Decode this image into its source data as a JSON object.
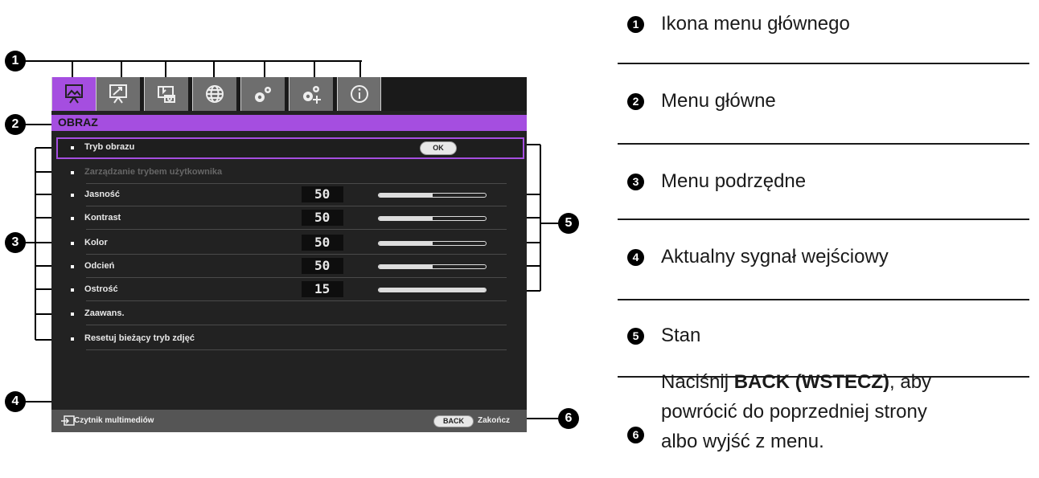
{
  "osd": {
    "tabs": [
      {
        "icon": "picture-icon"
      },
      {
        "icon": "display-icon"
      },
      {
        "icon": "installation-icon"
      },
      {
        "icon": "system-settings-globe-icon"
      },
      {
        "icon": "basic-settings-gears-icon"
      },
      {
        "icon": "advanced-settings-gears-icon"
      },
      {
        "icon": "information-icon"
      }
    ],
    "menu_title": "OBRAZ",
    "rows": [
      {
        "label": "Tryb obrazu",
        "button": "OK",
        "selected": true
      },
      {
        "label": "Zarządzanie trybem użytkownika",
        "dimmed": true
      },
      {
        "label": "Jasność",
        "value": "50",
        "level": 0.5
      },
      {
        "label": "Kontrast",
        "value": "50",
        "level": 0.5
      },
      {
        "label": "Kolor",
        "value": "50",
        "level": 0.5
      },
      {
        "label": "Odcień",
        "value": "50",
        "level": 0.5
      },
      {
        "label": "Ostrość",
        "value": "15",
        "level": 1.0
      },
      {
        "label": "Zaawans."
      },
      {
        "label": "Resetuj bieżący tryb zdjęć"
      }
    ],
    "status": {
      "source_label": "Czytnik multimediów",
      "back_button": "BACK",
      "exit_label": "Zakończ"
    }
  },
  "callouts": [
    "1",
    "2",
    "3",
    "4",
    "5",
    "6"
  ],
  "legend": {
    "item1": "Ikona menu głównego",
    "item2": "Menu główne",
    "item3": "Menu podrzędne",
    "item4": "Aktualny sygnał wejściowy",
    "item5": "Stan",
    "item6": {
      "pre": "Naciśnij ",
      "bold": "BACK (WSTECZ)",
      "line1_post": ", aby",
      "line2": "powrócić do poprzedniej strony",
      "line3": "albo wyjść z menu."
    }
  },
  "colors": {
    "accent": "#a54ee0",
    "tab_inactive": "#6e6e6e",
    "screen_bg": "#222222"
  }
}
